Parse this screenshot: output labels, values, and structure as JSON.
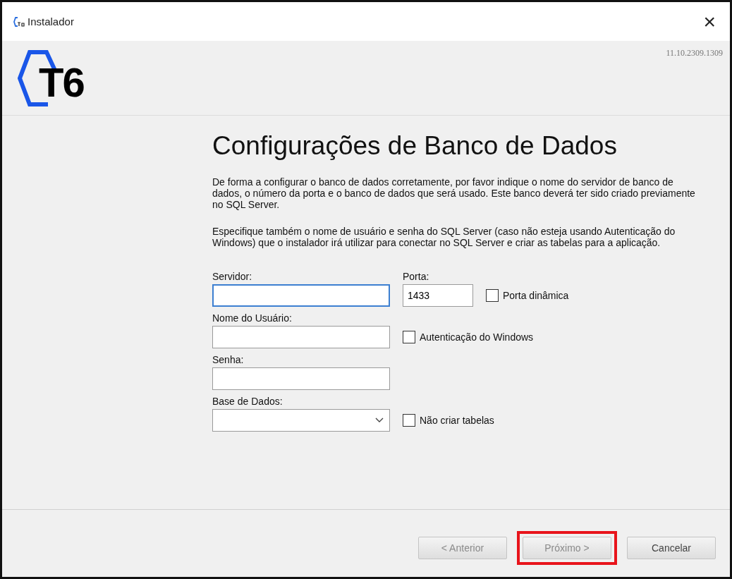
{
  "window": {
    "title": "Instalador",
    "close": "×"
  },
  "header": {
    "logo_text": "T6",
    "version": "11.10.2309.1309"
  },
  "page": {
    "heading": "Configurações de Banco de Dados",
    "paragraphs": [
      "De forma a configurar o banco de dados corretamente, por favor indique o nome do servidor de banco de dados, o número da porta e o banco de dados que será usado. Este banco deverá ter sido criado previamente no SQL Server.",
      "Especifique também o nome de usuário e senha do SQL Server (caso não esteja usando Autenticação do Windows) que o instalador irá utilizar para conectar no SQL Server e criar as tabelas para a aplicação."
    ]
  },
  "form": [
    {
      "label": "Servidor:",
      "kind": "text",
      "focused": true,
      "port": {
        "label": "Porta:",
        "value": "1433"
      },
      "checkbox": {
        "label": "Porta dinâmica",
        "checked": false
      }
    },
    {
      "label": "Nome do Usuário:",
      "kind": "text",
      "focused": false,
      "checkbox": {
        "label": "Autenticação do Windows",
        "checked": false
      }
    },
    {
      "label": "Senha:",
      "kind": "text",
      "focused": false
    },
    {
      "label": "Base de Dados:",
      "kind": "select",
      "focused": false,
      "checkbox": {
        "label": "Não criar tabelas",
        "checked": false
      }
    }
  ],
  "buttons": [
    {
      "label": "< Anterior",
      "disabled": true,
      "highlighted": false
    },
    {
      "label": "Próximo >",
      "disabled": true,
      "highlighted": true
    },
    {
      "label": "Cancelar",
      "disabled": false,
      "highlighted": false
    }
  ]
}
